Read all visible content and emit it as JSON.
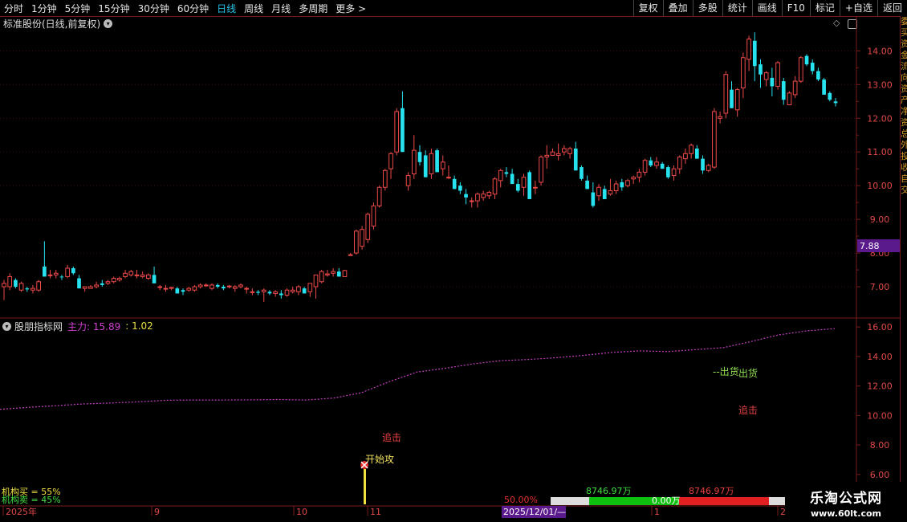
{
  "toolbar": {
    "periods": [
      "分时",
      "1分钟",
      "5分钟",
      "15分钟",
      "30分钟",
      "60分钟",
      "日线",
      "周线",
      "月线",
      "多周期",
      "更多 >"
    ],
    "active_index": 6,
    "buttons": [
      "复权",
      "叠加",
      "多股",
      "统计",
      "画线",
      "F10",
      "标记",
      "+自选",
      "返回"
    ]
  },
  "title": "标准股份(日线,前复权)",
  "price_axis": {
    "labels": [
      "14.00",
      "13.00",
      "12.00",
      "11.00",
      "10.00",
      "9.00",
      "8.00",
      "7.00"
    ],
    "current_price": "7.88"
  },
  "indicator": {
    "name": "股朋指标网",
    "main_label": "主力: 15.89",
    "second_label": ": 1.02",
    "axis_labels": [
      "16.00",
      "14.00",
      "12.00",
      "10.00",
      "8.00",
      "6.00"
    ],
    "annotations": {
      "chase1": "追击",
      "start": "开始攻",
      "ship1": "--出货",
      "ship2": "出货",
      "chase2": "追击"
    },
    "inst_buy": "机构买 = 55%",
    "inst_sell": "机构卖 = 45%"
  },
  "date_axis": {
    "labels": [
      "2025年",
      "9",
      "10",
      "11",
      "1",
      "2"
    ],
    "cursor_date": "2025/12/01/—"
  },
  "bottom_bar": {
    "percent": "50.00%",
    "left_amount": "8746.97万",
    "mid_amount": "0.00万",
    "right_amount": "8746.97万"
  },
  "watermark": {
    "line1": "乐淘公式网",
    "line2": "www.60lt.com"
  },
  "right_sidebar_text": "委买资金流向资产净资总外投收自交",
  "colors": {
    "up": "#f04a4a",
    "down": "#27e3ef",
    "axis_red": "#7a1c1c",
    "purple": "#c040c0",
    "active": "#27c5e8"
  },
  "chart_data": {
    "type": "candlestick",
    "title": "标准股份(日线,前复权)",
    "xlabel": "",
    "ylabel": "",
    "ylim": [
      6.5,
      14.7
    ],
    "x_ticks": [
      "2025年",
      "9",
      "10",
      "11",
      "1",
      "2"
    ],
    "ohlc": [
      [
        7.0,
        7.2,
        6.6,
        7.1
      ],
      [
        7.0,
        7.4,
        6.9,
        7.3
      ],
      [
        7.2,
        7.25,
        6.95,
        7.0
      ],
      [
        6.9,
        7.15,
        6.85,
        7.1
      ],
      [
        6.95,
        7.0,
        6.85,
        6.92
      ],
      [
        6.9,
        7.05,
        6.8,
        6.95
      ],
      [
        6.9,
        7.2,
        6.85,
        7.15
      ],
      [
        7.6,
        8.35,
        7.55,
        7.3
      ],
      [
        7.35,
        7.5,
        7.25,
        7.35
      ],
      [
        7.35,
        7.5,
        7.25,
        7.4
      ],
      [
        7.3,
        7.35,
        7.2,
        7.28
      ],
      [
        7.3,
        7.65,
        7.25,
        7.55
      ],
      [
        7.55,
        7.6,
        7.35,
        7.4
      ],
      [
        7.25,
        7.35,
        6.95,
        6.95
      ],
      [
        6.95,
        7.0,
        6.85,
        7.0
      ],
      [
        6.95,
        7.05,
        6.95,
        7.0
      ],
      [
        7.0,
        7.15,
        6.95,
        7.05
      ],
      [
        7.1,
        7.2,
        7.0,
        7.05
      ],
      [
        7.1,
        7.2,
        7.05,
        7.15
      ],
      [
        7.15,
        7.3,
        7.1,
        7.25
      ],
      [
        7.2,
        7.3,
        7.15,
        7.25
      ],
      [
        7.3,
        7.5,
        7.25,
        7.4
      ],
      [
        7.35,
        7.5,
        7.3,
        7.45
      ],
      [
        7.35,
        7.5,
        7.25,
        7.35
      ],
      [
        7.3,
        7.45,
        7.25,
        7.35
      ],
      [
        7.25,
        7.4,
        7.2,
        7.35
      ],
      [
        7.35,
        7.6,
        7.2,
        7.1
      ],
      [
        7.0,
        7.05,
        6.9,
        7.0
      ],
      [
        6.95,
        7.05,
        6.85,
        6.95
      ],
      [
        6.95,
        7.0,
        6.9,
        6.98
      ],
      [
        6.95,
        7.0,
        6.8,
        6.8
      ],
      [
        6.9,
        6.95,
        6.75,
        6.85
      ],
      [
        6.9,
        7.0,
        6.85,
        6.95
      ],
      [
        6.9,
        7.05,
        6.85,
        7.0
      ],
      [
        7.0,
        7.1,
        6.95,
        7.05
      ],
      [
        7.05,
        7.1,
        7.0,
        7.05
      ],
      [
        6.95,
        7.1,
        6.9,
        7.05
      ],
      [
        7.05,
        7.1,
        6.95,
        7.0
      ],
      [
        7.0,
        7.05,
        6.9,
        6.95
      ],
      [
        7.0,
        7.05,
        6.95,
        7.02
      ],
      [
        6.95,
        7.05,
        6.85,
        7.0
      ],
      [
        7.0,
        7.1,
        6.95,
        7.05
      ],
      [
        6.95,
        7.0,
        6.8,
        6.95
      ],
      [
        6.85,
        6.95,
        6.75,
        6.85
      ],
      [
        6.85,
        6.9,
        6.75,
        6.82
      ],
      [
        6.85,
        6.95,
        6.55,
        6.9
      ],
      [
        6.85,
        6.9,
        6.75,
        6.8
      ],
      [
        6.8,
        6.9,
        6.7,
        6.85
      ],
      [
        6.8,
        6.9,
        6.65,
        6.75
      ],
      [
        6.75,
        6.95,
        6.7,
        6.9
      ],
      [
        6.85,
        7.0,
        6.8,
        6.9
      ],
      [
        6.85,
        7.05,
        6.75,
        7.0
      ],
      [
        6.95,
        7.0,
        6.85,
        6.8
      ],
      [
        6.85,
        7.1,
        6.7,
        7.1
      ],
      [
        7.0,
        7.3,
        6.65,
        7.35
      ],
      [
        7.15,
        7.5,
        7.1,
        7.45
      ],
      [
        7.35,
        7.5,
        7.3,
        7.38
      ],
      [
        7.4,
        7.55,
        7.3,
        7.45
      ],
      [
        7.45,
        7.55,
        7.3,
        7.3
      ],
      [
        7.3,
        7.5,
        7.3,
        7.48
      ],
      [
        7.95,
        8.0,
        7.95,
        7.95
      ],
      [
        8.0,
        8.7,
        7.95,
        8.65
      ],
      [
        8.2,
        8.8,
        8.1,
        8.7
      ],
      [
        8.4,
        9.2,
        8.3,
        9.15
      ],
      [
        8.8,
        9.5,
        8.7,
        9.4
      ],
      [
        9.4,
        10.0,
        9.35,
        9.95
      ],
      [
        9.95,
        10.5,
        9.85,
        10.45
      ],
      [
        10.5,
        11.0,
        10.2,
        10.95
      ],
      [
        11.0,
        12.3,
        10.9,
        12.2
      ],
      [
        12.3,
        12.8,
        11.0,
        11.0
      ],
      [
        10.0,
        10.4,
        9.85,
        10.3
      ],
      [
        10.35,
        11.5,
        10.2,
        11.05
      ],
      [
        11.0,
        11.2,
        10.6,
        10.7
      ],
      [
        10.9,
        11.05,
        10.25,
        10.25
      ],
      [
        10.35,
        11.1,
        10.2,
        10.95
      ],
      [
        11.05,
        11.1,
        10.4,
        10.4
      ],
      [
        10.5,
        10.9,
        10.3,
        10.7
      ],
      [
        10.25,
        10.6,
        10.2,
        10.25
      ],
      [
        10.2,
        10.3,
        9.9,
        9.9
      ],
      [
        10.0,
        10.1,
        9.75,
        9.85
      ],
      [
        9.75,
        9.9,
        9.45,
        9.65
      ],
      [
        9.55,
        9.65,
        9.35,
        9.55
      ],
      [
        9.55,
        9.8,
        9.35,
        9.75
      ],
      [
        9.65,
        9.85,
        9.55,
        9.75
      ],
      [
        9.7,
        9.85,
        9.6,
        9.8
      ],
      [
        9.75,
        10.25,
        9.6,
        10.2
      ],
      [
        10.15,
        10.5,
        9.95,
        10.45
      ],
      [
        10.4,
        10.55,
        10.25,
        10.35
      ],
      [
        10.35,
        10.5,
        10.05,
        10.05
      ],
      [
        10.05,
        10.2,
        9.8,
        9.85
      ],
      [
        9.95,
        10.35,
        9.7,
        10.25
      ],
      [
        10.4,
        10.45,
        9.8,
        9.6
      ],
      [
        9.95,
        10.15,
        9.75,
        9.95
      ],
      [
        10.1,
        10.9,
        10.0,
        10.85
      ],
      [
        10.85,
        11.2,
        10.5,
        10.9
      ],
      [
        10.9,
        11.1,
        10.9,
        11.0
      ],
      [
        10.9,
        11.25,
        10.75,
        10.95
      ],
      [
        11.0,
        11.2,
        10.9,
        11.1
      ],
      [
        10.95,
        11.15,
        10.8,
        11.1
      ],
      [
        11.1,
        11.3,
        10.55,
        10.45
      ],
      [
        10.55,
        10.6,
        10.15,
        10.2
      ],
      [
        10.15,
        10.3,
        9.9,
        9.9
      ],
      [
        9.8,
        10.1,
        9.35,
        9.4
      ],
      [
        9.7,
        10.05,
        9.55,
        9.95
      ],
      [
        9.9,
        10.0,
        9.6,
        9.6
      ],
      [
        9.75,
        10.2,
        9.7,
        9.85
      ],
      [
        9.85,
        10.15,
        9.75,
        10.05
      ],
      [
        10.1,
        10.2,
        9.85,
        9.95
      ],
      [
        10.0,
        10.2,
        9.95,
        10.15
      ],
      [
        10.2,
        10.3,
        10.05,
        10.25
      ],
      [
        10.25,
        10.5,
        10.1,
        10.4
      ],
      [
        10.4,
        10.8,
        10.3,
        10.75
      ],
      [
        10.75,
        10.85,
        10.55,
        10.6
      ],
      [
        10.6,
        10.85,
        10.5,
        10.7
      ],
      [
        10.65,
        10.7,
        10.5,
        10.5
      ],
      [
        10.55,
        10.6,
        10.2,
        10.25
      ],
      [
        10.3,
        10.6,
        10.15,
        10.5
      ],
      [
        10.5,
        10.9,
        10.35,
        10.85
      ],
      [
        10.8,
        11.1,
        10.65,
        10.95
      ],
      [
        10.95,
        11.25,
        10.8,
        11.2
      ],
      [
        11.1,
        11.2,
        10.8,
        10.8
      ],
      [
        10.8,
        10.9,
        10.35,
        10.45
      ],
      [
        10.45,
        10.65,
        10.4,
        10.6
      ],
      [
        10.55,
        12.3,
        10.5,
        12.2
      ],
      [
        12.0,
        12.2,
        11.85,
        12.05
      ],
      [
        12.15,
        13.4,
        12.0,
        13.3
      ],
      [
        12.85,
        13.1,
        12.3,
        12.3
      ],
      [
        12.25,
        12.9,
        12.05,
        12.85
      ],
      [
        12.9,
        13.95,
        12.6,
        13.8
      ],
      [
        13.75,
        14.45,
        13.4,
        14.35
      ],
      [
        14.3,
        14.55,
        13.1,
        13.55
      ],
      [
        13.6,
        13.75,
        12.9,
        13.3
      ],
      [
        13.15,
        13.4,
        12.95,
        13.35
      ],
      [
        13.2,
        13.5,
        12.65,
        12.95
      ],
      [
        12.95,
        13.7,
        12.85,
        13.65
      ],
      [
        13.1,
        13.2,
        12.4,
        12.55
      ],
      [
        12.4,
        12.8,
        12.4,
        12.75
      ],
      [
        12.7,
        13.25,
        12.6,
        13.1
      ],
      [
        13.1,
        13.85,
        13.05,
        13.8
      ],
      [
        13.85,
        13.9,
        13.55,
        13.6
      ],
      [
        13.65,
        13.75,
        13.3,
        13.4
      ],
      [
        13.4,
        13.5,
        13.1,
        13.15
      ],
      [
        13.15,
        13.2,
        12.8,
        12.7
      ],
      [
        12.75,
        12.8,
        12.5,
        12.55
      ],
      [
        12.5,
        12.6,
        12.35,
        12.45
      ]
    ],
    "series": [
      {
        "name": "主力",
        "values": [
          10.42,
          10.55,
          10.66,
          10.78,
          10.85,
          10.93,
          11.03,
          11.05,
          11.05,
          11.06,
          11.08,
          11.05,
          11.18,
          11.55,
          12.3,
          12.95,
          13.2,
          13.5,
          13.72,
          13.8,
          13.92,
          14.08,
          14.28,
          14.38,
          14.33,
          14.47,
          14.6,
          15.02,
          15.47,
          15.74,
          15.89
        ]
      }
    ],
    "indicator_ylim": [
      5.5,
      16.5
    ]
  }
}
